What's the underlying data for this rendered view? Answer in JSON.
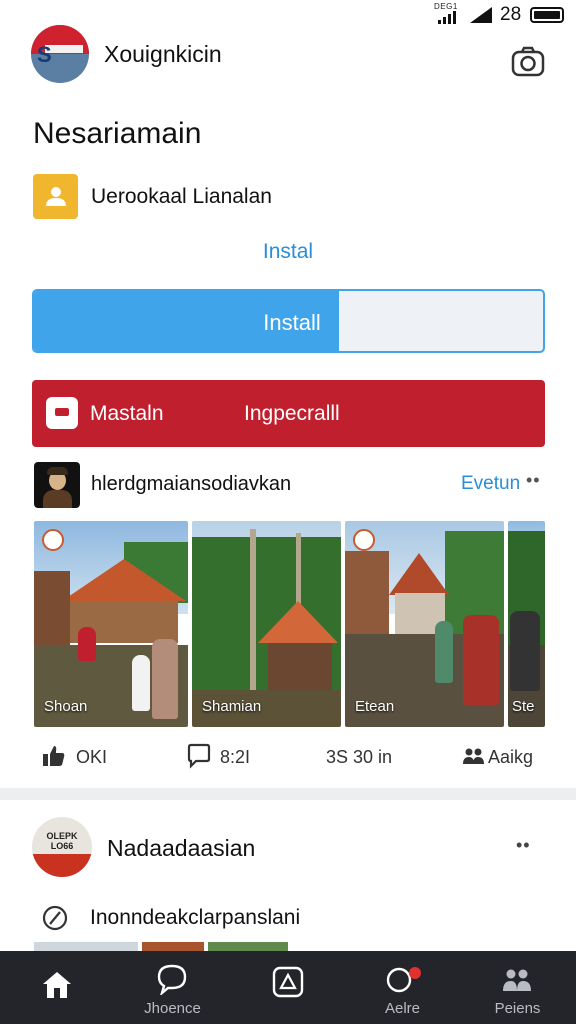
{
  "status_bar": {
    "network_label": "DEG1",
    "time": "28",
    "icons": [
      "signal-icon",
      "wifi-icon",
      "battery-icon"
    ]
  },
  "header": {
    "app_name": "Xouignkicin",
    "camera_icon": "camera-icon"
  },
  "page_title": "Nesariamain",
  "account": {
    "label": "Uerookaal Lianalan",
    "icon": "user-icon"
  },
  "install_link": "Instal",
  "install_bar": {
    "label": "Install",
    "progress": 0.6
  },
  "banner": {
    "left_label": "Mastaln",
    "right_label": "Ingpecralll",
    "color": "#c0202e"
  },
  "post1": {
    "author": "hlerdgmaiansodiavkan",
    "follow_label": "Evetun",
    "more": "••",
    "photos": [
      {
        "caption": "Shoan"
      },
      {
        "caption": "Shamian"
      },
      {
        "caption": "Etean"
      },
      {
        "caption": "Ste"
      }
    ],
    "actions": [
      {
        "icon": "thumbs-up-icon",
        "label": "OKI"
      },
      {
        "icon": "comment-icon",
        "label": "8:2I"
      },
      {
        "icon": "share-icon",
        "label": "3S 30 in"
      },
      {
        "icon": "people-icon",
        "label": "Aaikg"
      }
    ]
  },
  "post2": {
    "author": "Nadaadaasian",
    "avatar_text": "OLEPK LO66",
    "more": "••",
    "text": "Inonndeakclarpanslani",
    "icon": "slash-circle-icon"
  },
  "bottom_nav": {
    "items": [
      {
        "icon": "home-icon",
        "label": ""
      },
      {
        "icon": "chat-icon",
        "label": "Jhoence"
      },
      {
        "icon": "compass-icon",
        "label": ""
      },
      {
        "icon": "notification-icon",
        "label": "Aelre"
      },
      {
        "icon": "people-icon",
        "label": "Peiens"
      }
    ]
  },
  "colors": {
    "accent_blue": "#40a4ea",
    "link_blue": "#2a8ed6",
    "nav_bg": "#23252a"
  }
}
